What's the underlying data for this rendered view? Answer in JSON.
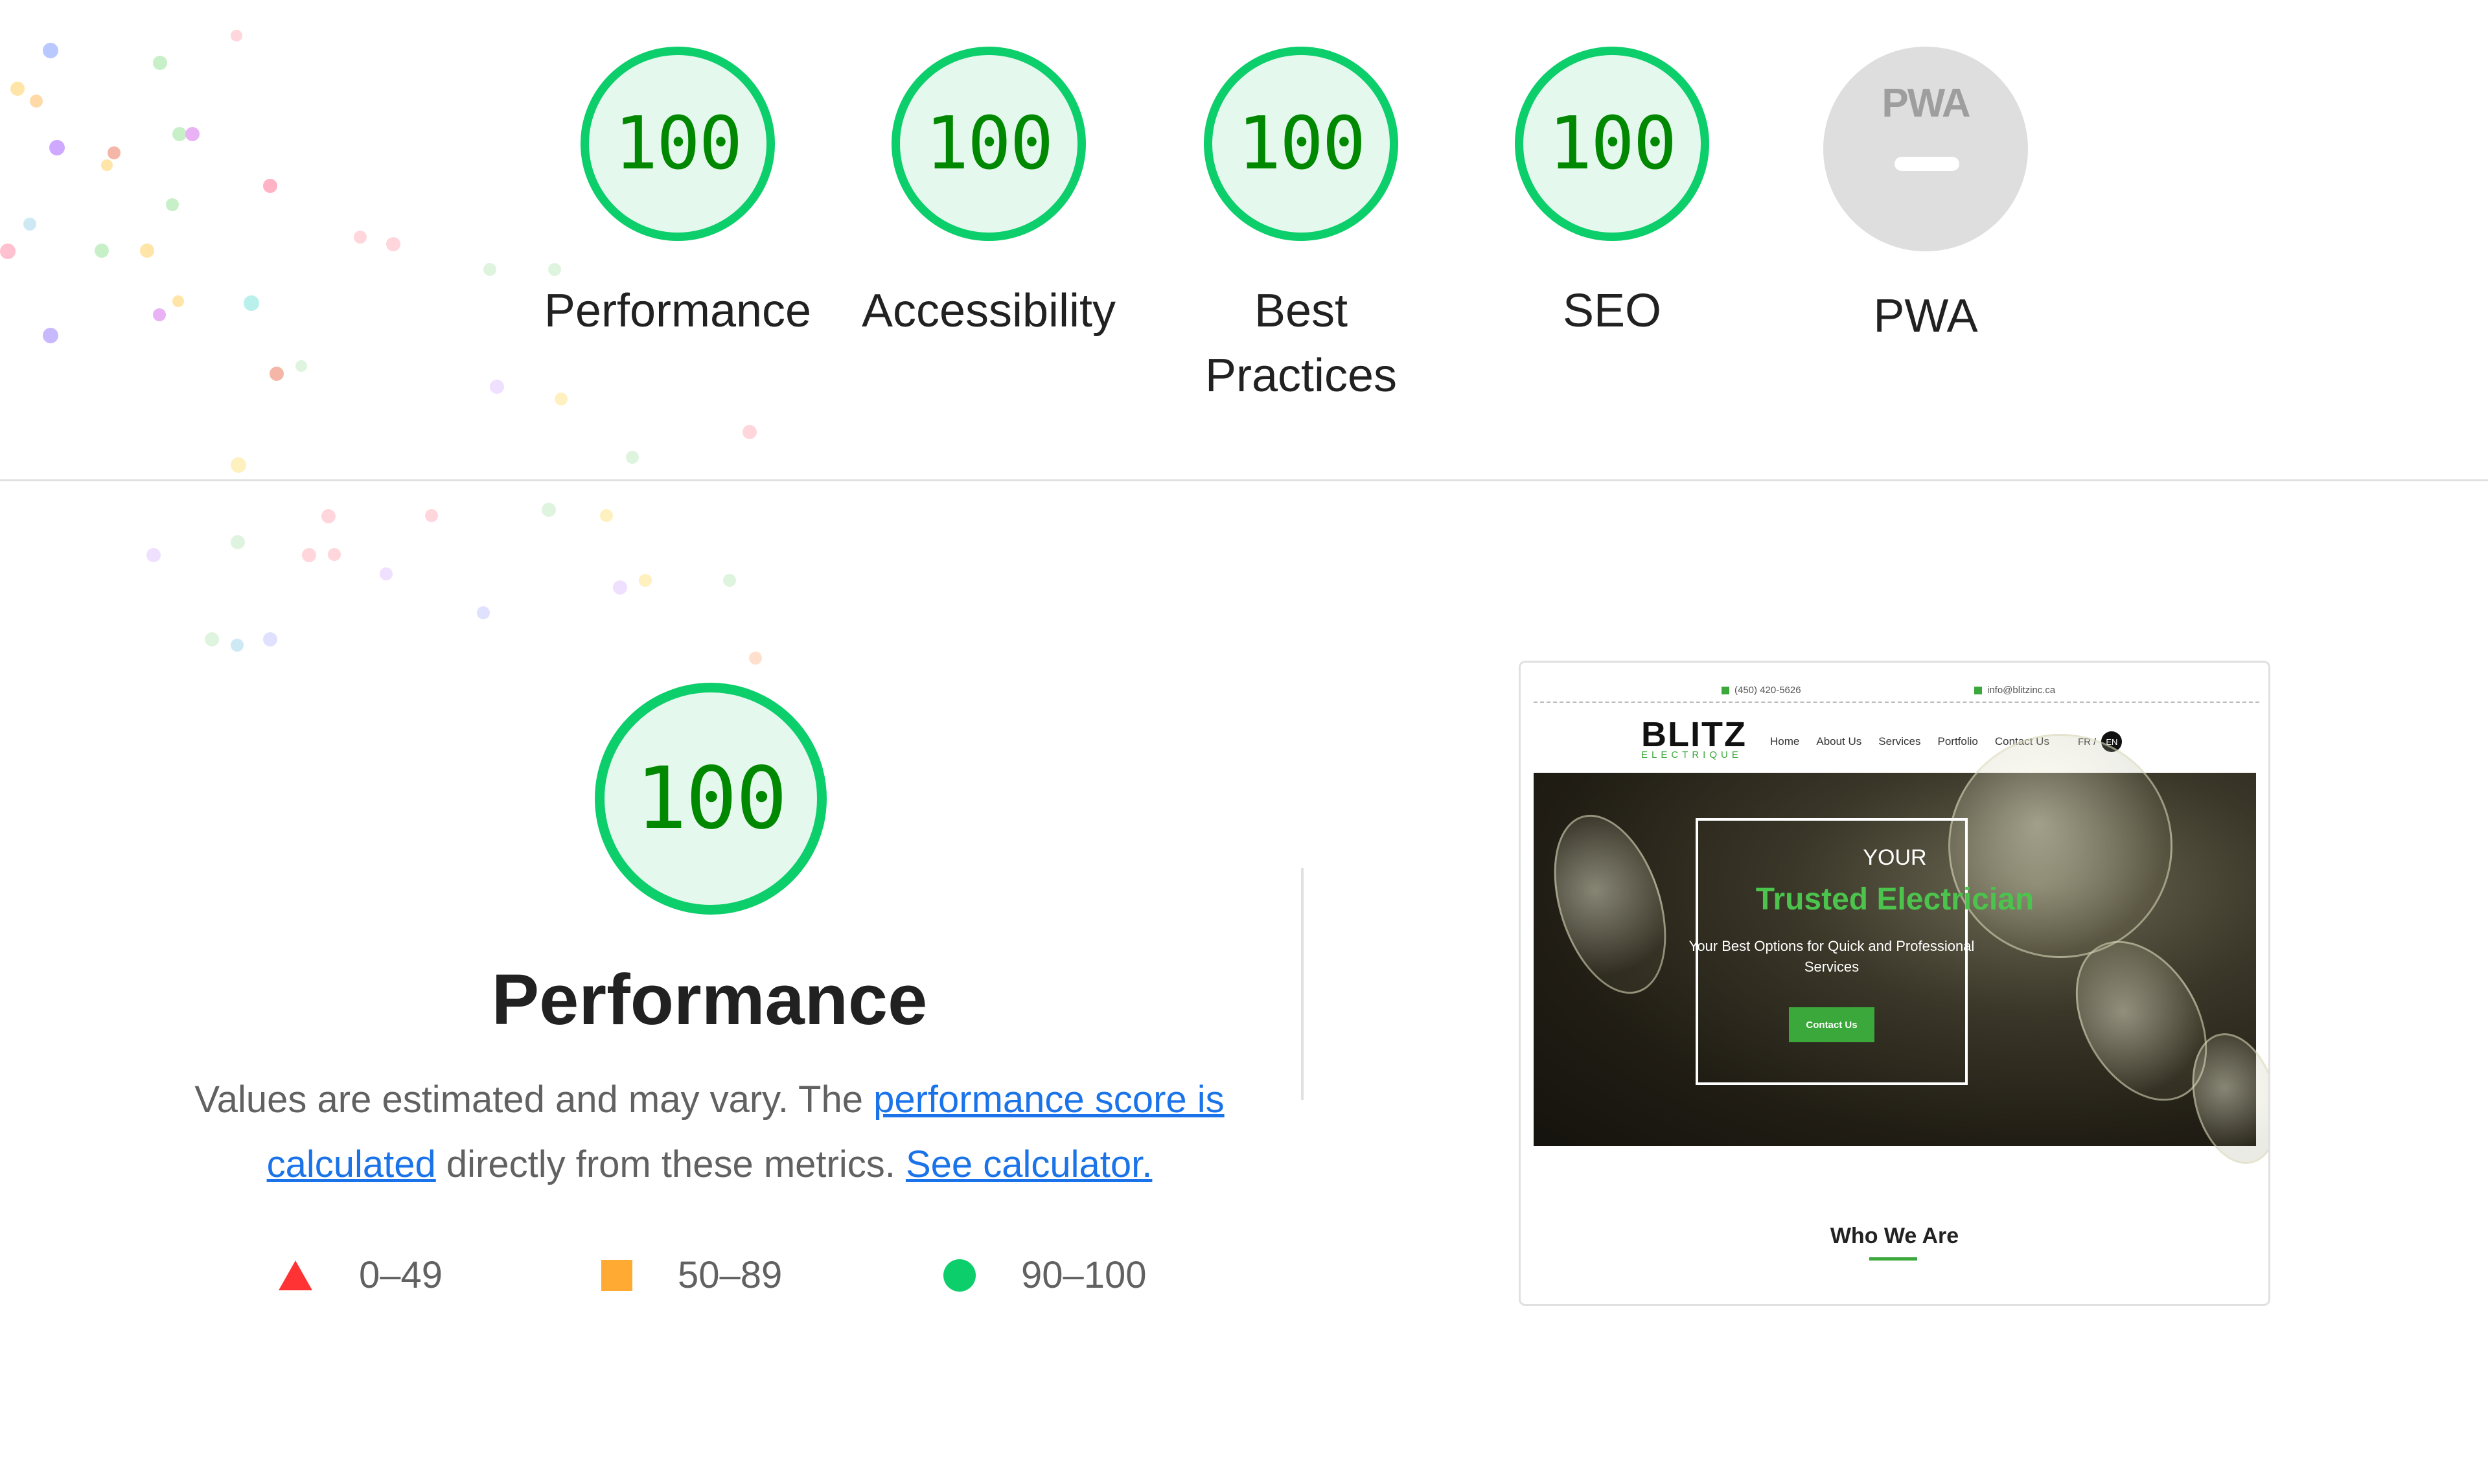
{
  "gauges": [
    {
      "score": "100",
      "label": "Performance"
    },
    {
      "score": "100",
      "label": "Accessibility"
    },
    {
      "score": "100",
      "label": "Best Practices"
    },
    {
      "score": "100",
      "label": "SEO"
    }
  ],
  "pwa": {
    "icon_text": "PWA",
    "label": "PWA"
  },
  "performance": {
    "score": "100",
    "title": "Performance",
    "desc_prefix": "Values are estimated and may vary. The ",
    "desc_link1": "performance score is calculated",
    "desc_middle": " directly from these metrics. ",
    "desc_link2": "See calculator."
  },
  "legend": [
    {
      "icon": "red-triangle-icon",
      "label": "0–49",
      "color": "#ff3333"
    },
    {
      "icon": "orange-square-icon",
      "label": "50–89",
      "color": "#ffaa33"
    },
    {
      "icon": "green-circle-icon",
      "label": "90–100",
      "color": "#0cce6b"
    }
  ],
  "thumbnail": {
    "phone": "(450) 420-5626",
    "email": "info@blitzinc.ca",
    "logo": "BLITZ",
    "logo_sub": "ELECTRIQUE",
    "nav": [
      "Home",
      "About Us",
      "Services",
      "Portfolio",
      "Contact Us"
    ],
    "lang_fr": "FR /",
    "lang_en": "EN",
    "hero_line1": "YOUR",
    "hero_line2": "Trusted Electrician",
    "hero_sub": "Your Best Options for Quick and Professional Services",
    "hero_button": "Contact Us",
    "section_title": "Who We Are"
  },
  "colors": {
    "pass": "#0cce6b",
    "pass_text": "#008800",
    "pass_bg": "#e5f8ee",
    "link": "#1a73e8",
    "brand_green": "#3aa83a"
  }
}
